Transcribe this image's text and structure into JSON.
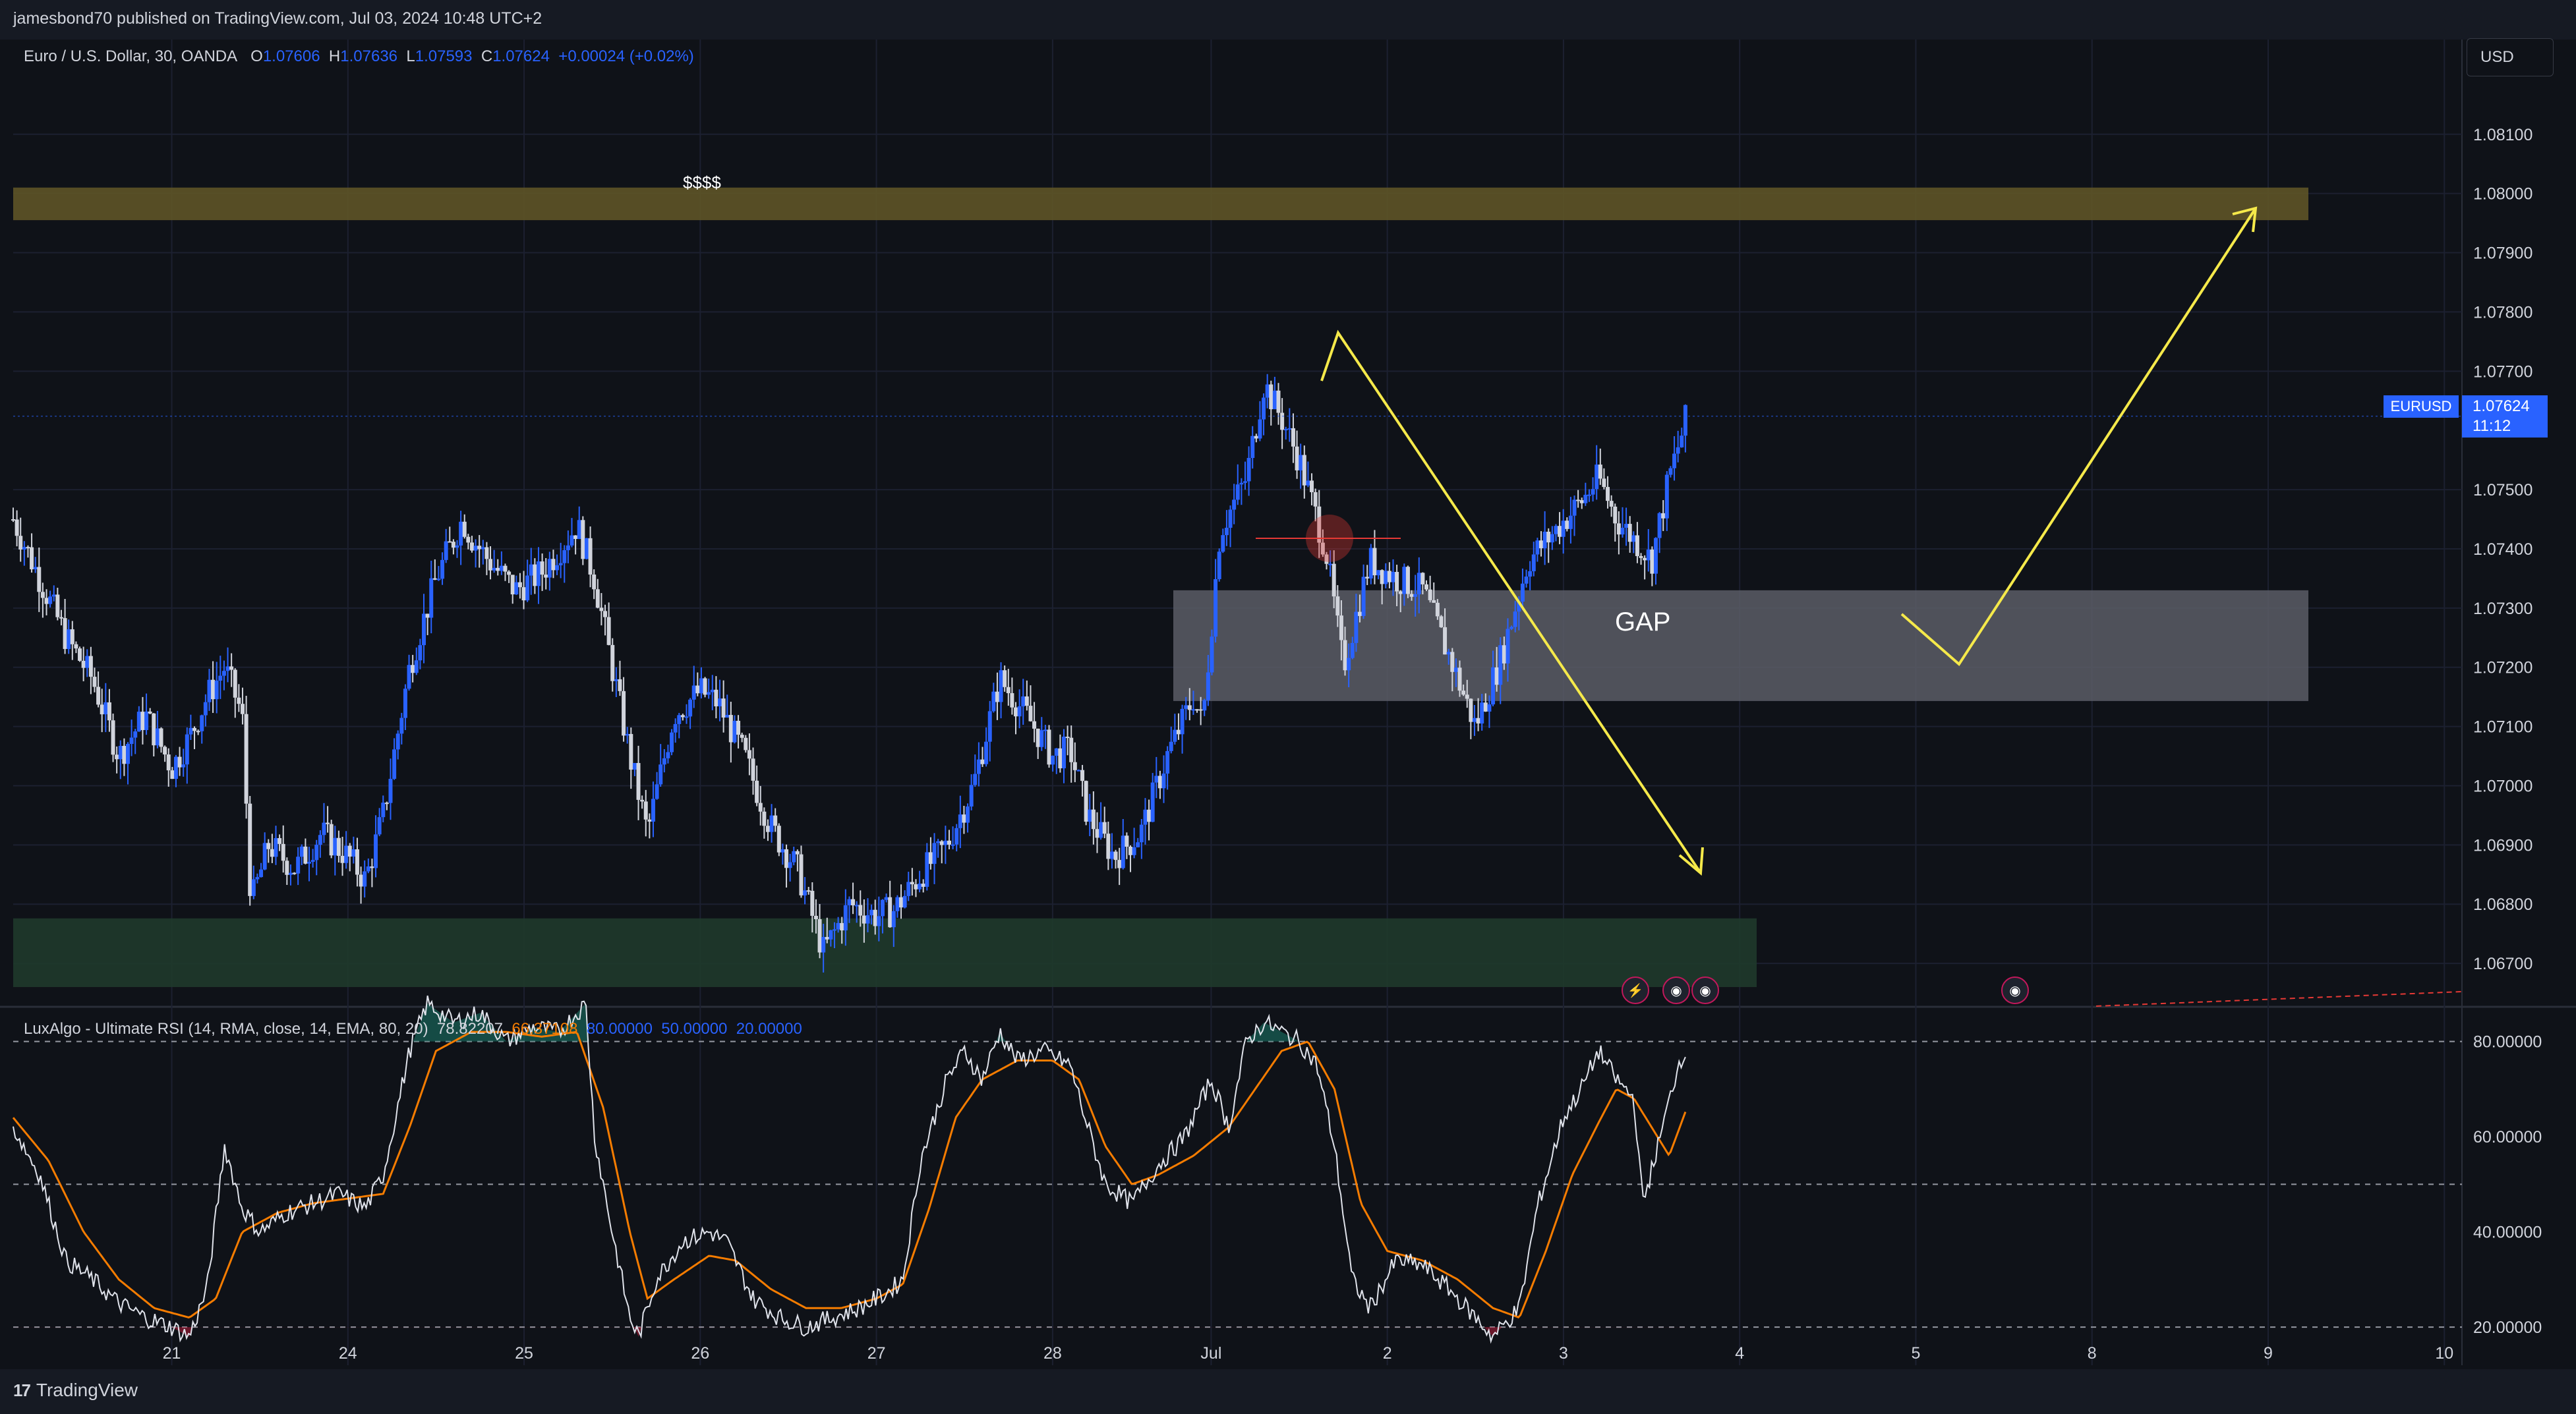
{
  "header": {
    "publisher_line": "jamesbond70 published on TradingView.com, Jul 03, 2024 10:48 UTC+2"
  },
  "legend": {
    "symbol": "Euro / U.S. Dollar, 30, OANDA",
    "o_label": "O",
    "o_value": "1.07606",
    "h_label": "H",
    "h_value": "1.07636",
    "l_label": "L",
    "l_value": "1.07593",
    "c_label": "C",
    "c_value": "1.07624",
    "change": "+0.00024 (+0.02%)"
  },
  "currency_button": "USD",
  "last_price": {
    "symbol": "EURUSD",
    "price": "1.07624",
    "countdown": "11:12"
  },
  "annotations": {
    "supply_zone_label": "$$$$",
    "gap_label": "GAP"
  },
  "rsi_legend": {
    "name": "LuxAlgo - Ultimate RSI (14, RMA, close, 14, EMA, 80, 20)",
    "rsi_value": "78.82207",
    "signal_value": "66.37108",
    "ob": "80.00000",
    "mid": "50.00000",
    "os": "20.00000"
  },
  "footer": {
    "brand": "TradingView"
  },
  "colors": {
    "bg": "#0f1218",
    "grid": "#1c2030",
    "up": "#2962ff",
    "down": "#d1d4dc",
    "arrow": "#f5e94a",
    "zone_top": "#5e5427",
    "zone_bottom": "#1f3a2b",
    "gap": "#5a5d66",
    "rsi": "#e0e3eb",
    "signal": "#f57c00"
  },
  "chart_data": [
    {
      "type": "candlestick",
      "title": "Euro / U.S. Dollar, 30, OANDA",
      "x_ticks": [
        "21",
        "24",
        "25",
        "26",
        "27",
        "28",
        "Jul",
        "2",
        "3",
        "4",
        "5",
        "8",
        "9",
        "10"
      ],
      "y_ticks": [
        "1.08100",
        "1.08000",
        "1.07900",
        "1.07800",
        "1.07700",
        "1.07500",
        "1.07400",
        "1.07300",
        "1.07200",
        "1.07100",
        "1.07000",
        "1.06900",
        "1.06800",
        "1.06700"
      ],
      "ylim": [
        1.0663,
        1.0826
      ],
      "series": [
        {
          "name": "EURUSD close (approx.)",
          "points": [
            [
              0,
              1.0745
            ],
            [
              0.15,
              1.0735
            ],
            [
              0.3,
              1.0725
            ],
            [
              0.45,
              1.0718
            ],
            [
              0.6,
              1.0705
            ],
            [
              0.75,
              1.0712
            ],
            [
              0.9,
              1.0703
            ],
            [
              1.0,
              1.0708
            ],
            [
              1.1,
              1.0715
            ],
            [
              1.2,
              1.072
            ],
            [
              1.3,
              1.0712
            ],
            [
              1.35,
              1.068
            ],
            [
              1.45,
              1.069
            ],
            [
              1.6,
              1.0686
            ],
            [
              1.75,
              1.0692
            ],
            [
              1.9,
              1.0688
            ],
            [
              2.0,
              1.0684
            ],
            [
              2.1,
              1.0695
            ],
            [
              2.25,
              1.072
            ],
            [
              2.4,
              1.0735
            ],
            [
              2.55,
              1.0745
            ],
            [
              2.6,
              1.0742
            ],
            [
              2.7,
              1.0738
            ],
            [
              2.85,
              1.0733
            ],
            [
              3.0,
              1.0736
            ],
            [
              3.1,
              1.074
            ],
            [
              3.2,
              1.0744
            ],
            [
              3.3,
              1.0735
            ],
            [
              3.4,
              1.072
            ],
            [
              3.5,
              1.0705
            ],
            [
              3.6,
              1.0692
            ],
            [
              3.75,
              1.0712
            ],
            [
              3.9,
              1.0716
            ],
            [
              4.0,
              1.0714
            ],
            [
              4.15,
              1.0705
            ],
            [
              4.3,
              1.0693
            ],
            [
              4.45,
              1.0686
            ],
            [
              4.6,
              1.0672
            ],
            [
              4.75,
              1.068
            ],
            [
              4.9,
              1.0678
            ],
            [
              5.0,
              1.0679
            ],
            [
              5.15,
              1.0685
            ],
            [
              5.3,
              1.069
            ],
            [
              5.45,
              1.07
            ],
            [
              5.6,
              1.0718
            ],
            [
              5.75,
              1.0712
            ],
            [
              5.9,
              1.0705
            ],
            [
              6.0,
              1.0706
            ],
            [
              6.1,
              1.0695
            ],
            [
              6.25,
              1.0688
            ],
            [
              6.4,
              1.0692
            ],
            [
              6.55,
              1.0705
            ],
            [
              6.7,
              1.0715
            ],
            [
              6.75,
              1.071
            ],
            [
              6.85,
              1.0743
            ],
            [
              7.0,
              1.0752
            ],
            [
              7.1,
              1.0768
            ],
            [
              7.2,
              1.0762
            ],
            [
              7.3,
              1.0755
            ],
            [
              7.45,
              1.074
            ],
            [
              7.55,
              1.072
            ],
            [
              7.7,
              1.0738
            ],
            [
              7.85,
              1.0735
            ],
            [
              8.0,
              1.0733
            ],
            [
              8.15,
              1.0722
            ],
            [
              8.3,
              1.071
            ],
            [
              8.45,
              1.0722
            ],
            [
              8.6,
              1.0738
            ],
            [
              8.75,
              1.0743
            ],
            [
              8.9,
              1.0748
            ],
            [
              9.0,
              1.0752
            ],
            [
              9.1,
              1.0745
            ],
            [
              9.25,
              1.074
            ],
            [
              9.3,
              1.0738
            ],
            [
              9.4,
              1.0752
            ],
            [
              9.5,
              1.07624
            ]
          ]
        }
      ],
      "zones": [
        {
          "label": "$$$$",
          "y_from": 1.07955,
          "y_to": 1.0801
        },
        {
          "label": "GAP",
          "y_from": 1.07143,
          "y_to": 1.0733
        },
        {
          "label": "",
          "y_from": 1.0666,
          "y_to": 1.06776
        }
      ],
      "last_price": 1.07624
    },
    {
      "type": "line",
      "title": "LuxAlgo - Ultimate RSI (14, RMA, close, 14, EMA, 80, 20)",
      "y_ticks": [
        "80.00000",
        "60.00000",
        "40.00000",
        "20.00000"
      ],
      "ylim": [
        12,
        87
      ],
      "levels": [
        80,
        50,
        20
      ],
      "series": [
        {
          "name": "Ultimate RSI",
          "points": [
            [
              0,
              62
            ],
            [
              0.15,
              52
            ],
            [
              0.3,
              34
            ],
            [
              0.45,
              30
            ],
            [
              0.6,
              25
            ],
            [
              0.75,
              22
            ],
            [
              0.9,
              20
            ],
            [
              1.0,
              18
            ],
            [
              1.1,
              28
            ],
            [
              1.2,
              58
            ],
            [
              1.3,
              45
            ],
            [
              1.4,
              40
            ],
            [
              1.55,
              44
            ],
            [
              1.7,
              46
            ],
            [
              1.85,
              48
            ],
            [
              2.0,
              45
            ],
            [
              2.1,
              52
            ],
            [
              2.25,
              78
            ],
            [
              2.35,
              88
            ],
            [
              2.5,
              84
            ],
            [
              2.65,
              86
            ],
            [
              2.8,
              80
            ],
            [
              2.95,
              83
            ],
            [
              3.1,
              82
            ],
            [
              3.25,
              88
            ],
            [
              3.3,
              60
            ],
            [
              3.4,
              40
            ],
            [
              3.5,
              22
            ],
            [
              3.55,
              18
            ],
            [
              3.65,
              30
            ],
            [
              3.8,
              38
            ],
            [
              3.95,
              40
            ],
            [
              4.05,
              38
            ],
            [
              4.2,
              26
            ],
            [
              4.35,
              22
            ],
            [
              4.5,
              20
            ],
            [
              4.65,
              22
            ],
            [
              4.8,
              24
            ],
            [
              4.95,
              27
            ],
            [
              5.05,
              30
            ],
            [
              5.15,
              55
            ],
            [
              5.3,
              72
            ],
            [
              5.4,
              78
            ],
            [
              5.5,
              72
            ],
            [
              5.6,
              82
            ],
            [
              5.7,
              76
            ],
            [
              5.85,
              78
            ],
            [
              6.0,
              75
            ],
            [
              6.1,
              62
            ],
            [
              6.2,
              50
            ],
            [
              6.35,
              46
            ],
            [
              6.5,
              54
            ],
            [
              6.65,
              60
            ],
            [
              6.8,
              72
            ],
            [
              6.9,
              62
            ],
            [
              7.0,
              80
            ],
            [
              7.1,
              84
            ],
            [
              7.2,
              82
            ],
            [
              7.3,
              80
            ],
            [
              7.4,
              75
            ],
            [
              7.5,
              58
            ],
            [
              7.6,
              30
            ],
            [
              7.7,
              24
            ],
            [
              7.85,
              34
            ],
            [
              8.0,
              33
            ],
            [
              8.15,
              28
            ],
            [
              8.3,
              22
            ],
            [
              8.4,
              18
            ],
            [
              8.55,
              24
            ],
            [
              8.65,
              45
            ],
            [
              8.8,
              64
            ],
            [
              8.9,
              70
            ],
            [
              9.0,
              78
            ],
            [
              9.1,
              72
            ],
            [
              9.2,
              68
            ],
            [
              9.25,
              46
            ],
            [
              9.35,
              60
            ],
            [
              9.45,
              75
            ],
            [
              9.5,
              79
            ]
          ]
        },
        {
          "name": "Signal",
          "points": [
            [
              0,
              64
            ],
            [
              0.2,
              55
            ],
            [
              0.4,
              40
            ],
            [
              0.6,
              30
            ],
            [
              0.8,
              24
            ],
            [
              1.0,
              22
            ],
            [
              1.15,
              26
            ],
            [
              1.3,
              40
            ],
            [
              1.5,
              44
            ],
            [
              1.7,
              46
            ],
            [
              1.9,
              47
            ],
            [
              2.1,
              48
            ],
            [
              2.25,
              62
            ],
            [
              2.4,
              78
            ],
            [
              2.6,
              82
            ],
            [
              2.8,
              82
            ],
            [
              3.0,
              81
            ],
            [
              3.2,
              82
            ],
            [
              3.35,
              66
            ],
            [
              3.5,
              40
            ],
            [
              3.6,
              26
            ],
            [
              3.75,
              30
            ],
            [
              3.95,
              35
            ],
            [
              4.1,
              34
            ],
            [
              4.3,
              28
            ],
            [
              4.5,
              24
            ],
            [
              4.7,
              24
            ],
            [
              4.9,
              26
            ],
            [
              5.05,
              29
            ],
            [
              5.2,
              45
            ],
            [
              5.35,
              64
            ],
            [
              5.5,
              72
            ],
            [
              5.7,
              76
            ],
            [
              5.9,
              76
            ],
            [
              6.05,
              72
            ],
            [
              6.2,
              58
            ],
            [
              6.35,
              50
            ],
            [
              6.5,
              52
            ],
            [
              6.7,
              56
            ],
            [
              6.9,
              62
            ],
            [
              7.05,
              70
            ],
            [
              7.2,
              78
            ],
            [
              7.35,
              80
            ],
            [
              7.5,
              70
            ],
            [
              7.65,
              46
            ],
            [
              7.8,
              36
            ],
            [
              8.0,
              34
            ],
            [
              8.2,
              30
            ],
            [
              8.4,
              24
            ],
            [
              8.55,
              22
            ],
            [
              8.7,
              36
            ],
            [
              8.85,
              52
            ],
            [
              9.0,
              63
            ],
            [
              9.1,
              70
            ],
            [
              9.2,
              68
            ],
            [
              9.3,
              62
            ],
            [
              9.4,
              56
            ],
            [
              9.5,
              66
            ]
          ]
        }
      ]
    }
  ]
}
